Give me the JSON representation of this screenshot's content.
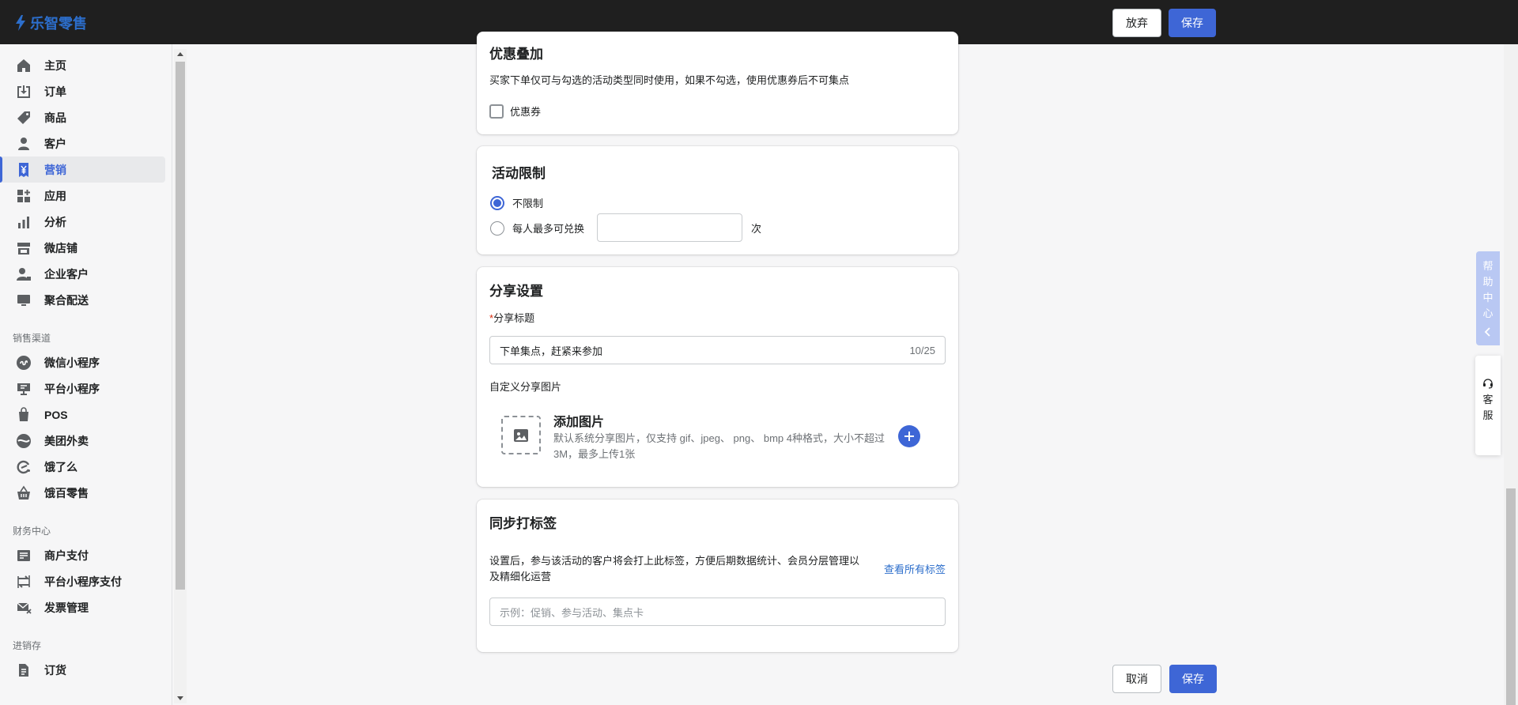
{
  "app": {
    "brand": "乐智零售"
  },
  "topbar": {
    "discard_label": "放弃",
    "save_label": "保存"
  },
  "sidebar": {
    "main": [
      {
        "label": "主页",
        "icon": "home-icon"
      },
      {
        "label": "订单",
        "icon": "orders-icon"
      },
      {
        "label": "商品",
        "icon": "tag-icon"
      },
      {
        "label": "客户",
        "icon": "person-icon"
      },
      {
        "label": "营销",
        "icon": "yen-icon",
        "active": true
      },
      {
        "label": "应用",
        "icon": "apps-icon"
      },
      {
        "label": "分析",
        "icon": "bar-chart-icon"
      },
      {
        "label": "微店铺",
        "icon": "store-icon"
      },
      {
        "label": "企业客户",
        "icon": "business-customer-icon"
      },
      {
        "label": "聚合配送",
        "icon": "monitor-icon"
      }
    ],
    "sales_channel_title": "销售渠道",
    "sales_channels": [
      {
        "label": "微信小程序",
        "icon": "mini-program-icon"
      },
      {
        "label": "平台小程序",
        "icon": "platform-icon"
      },
      {
        "label": "POS",
        "icon": "pos-bag-icon"
      },
      {
        "label": "美团外卖",
        "icon": "meituan-icon"
      },
      {
        "label": "饿了么",
        "icon": "eleme-icon"
      },
      {
        "label": "饿百零售",
        "icon": "basket-icon"
      }
    ],
    "finance_title": "财务中心",
    "finance": [
      {
        "label": "商户支付",
        "icon": "payment-icon"
      },
      {
        "label": "平台小程序支付",
        "icon": "transfer-icon"
      },
      {
        "label": "发票管理",
        "icon": "invoice-icon"
      }
    ],
    "inventory_title": "进销存",
    "inventory": [
      {
        "label": "订货",
        "icon": "document-icon"
      }
    ]
  },
  "discount_card": {
    "title": "优惠叠加",
    "description": "买家下单仅可与勾选的活动类型同时使用，如果不勾选，使用优惠券后不可集点",
    "coupon_label": "优惠券",
    "coupon_checked": false
  },
  "limit_card": {
    "title": "活动限制",
    "option_unlimited": "不限制",
    "option_per_person": "每人最多可兑换",
    "per_person_value": "",
    "unit": "次",
    "selected": "unlimited"
  },
  "share_card": {
    "title": "分享设置",
    "required_mark": "*",
    "share_title_label": "分享标题",
    "share_title_value": "下单集点，赶紧来参加",
    "char_count": "10/25",
    "custom_image_label": "自定义分享图片",
    "add_image_title": "添加图片",
    "add_image_desc": "默认系统分享图片，仅支持 gif、jpeg、 png、 bmp 4种格式，大小不超过 3M，最多上传1张"
  },
  "tag_card": {
    "title": "同步打标签",
    "description": "设置后，参与该活动的客户将会打上此标签，方便后期数据统计、会员分层管理以及精细化运营",
    "view_all_link": "查看所有标签",
    "input_placeholder": "示例：促销、参与活动、集点卡"
  },
  "help": {
    "help_center": [
      "帮",
      "助",
      "中",
      "心"
    ],
    "customer_service": [
      "客",
      "服"
    ]
  },
  "bottom": {
    "cancel_label": "取消",
    "save_label": "保存"
  },
  "colors": {
    "primary": "#3e66d6",
    "topbar": "#1f1f1f",
    "brand": "#2c6ecb"
  }
}
